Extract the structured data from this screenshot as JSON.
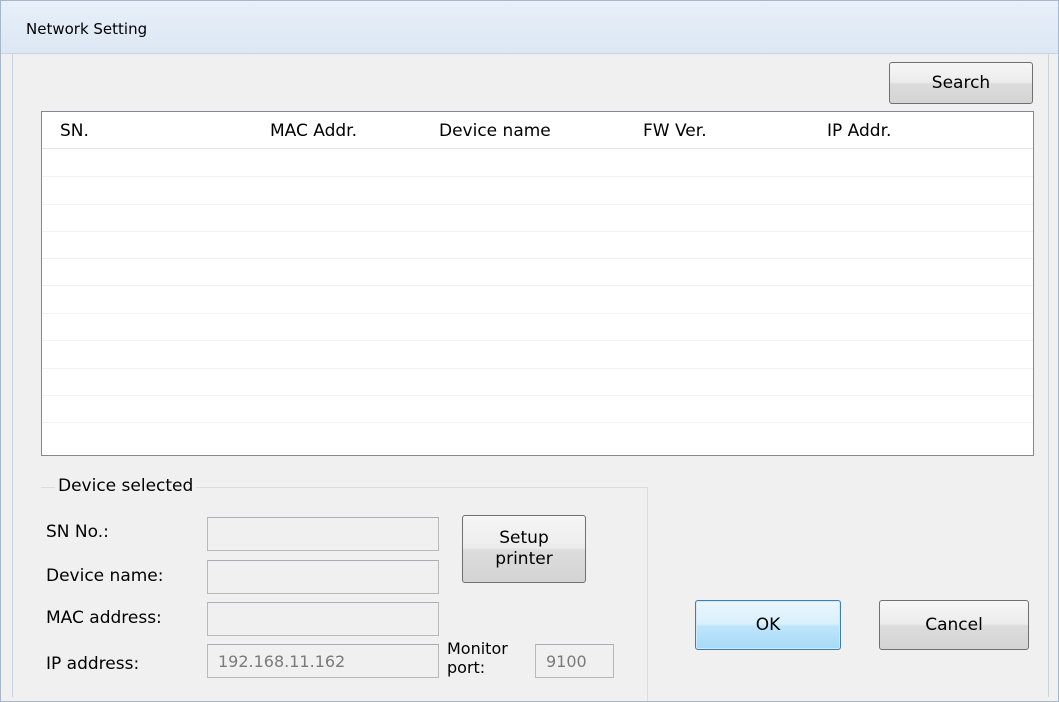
{
  "window": {
    "title": "Network Setting"
  },
  "buttons": {
    "search": "Search",
    "setup_printer": "Setup\nprinter",
    "ok": "OK",
    "cancel": "Cancel"
  },
  "list": {
    "columns": [
      "SN.",
      "MAC Addr.",
      "Device name",
      "FW Ver.",
      "IP Addr."
    ],
    "rows": []
  },
  "device_selected": {
    "group_label": "Device selected",
    "sn_label": "SN No.:",
    "sn_value": "",
    "name_label": "Device name:",
    "name_value": "",
    "mac_label": "MAC address:",
    "mac_value": "",
    "ip_label": "IP address:",
    "ip_value": "192.168.11.162",
    "port_label": "Monitor\nport:",
    "port_value": "9100"
  }
}
